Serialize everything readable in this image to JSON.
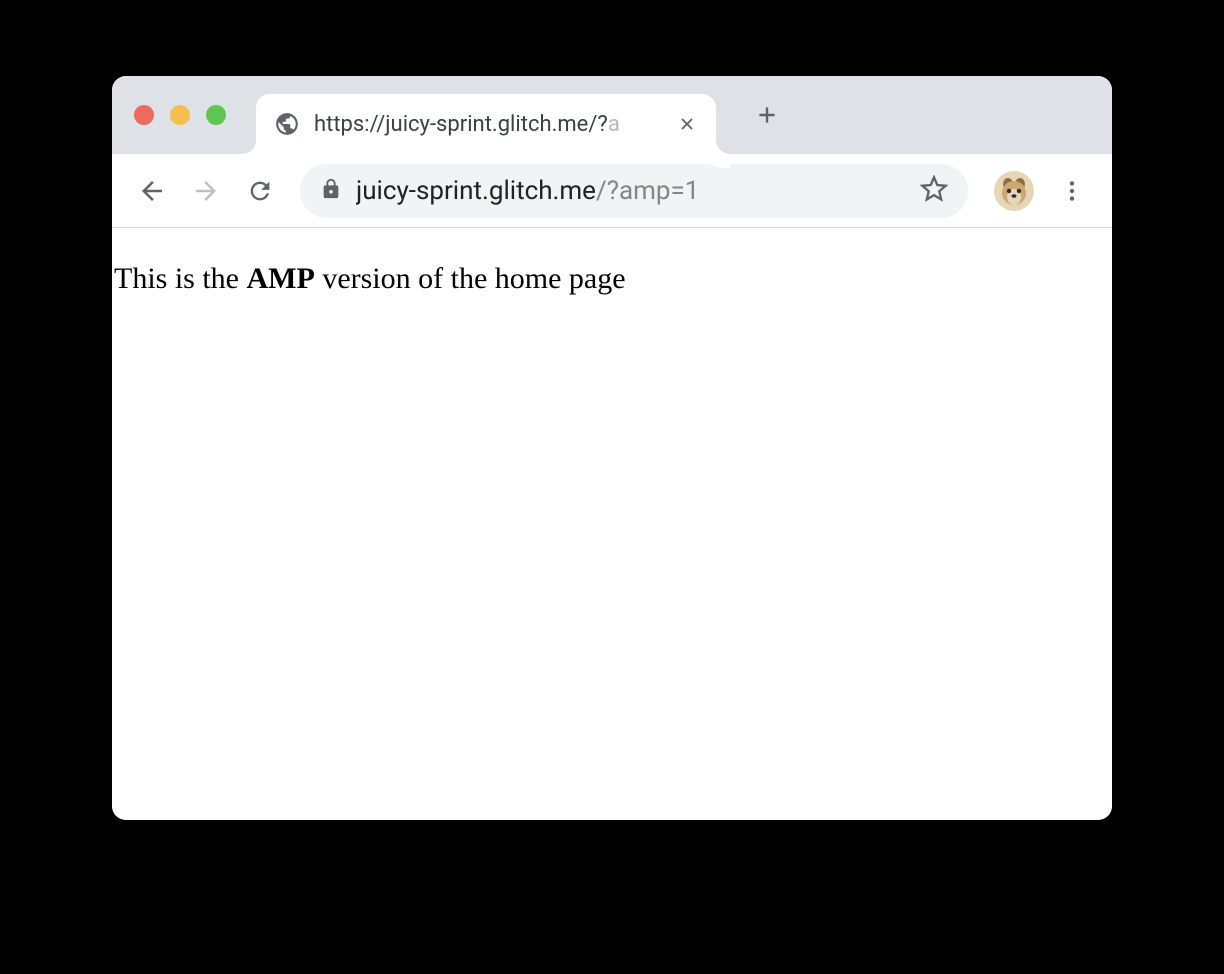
{
  "tab": {
    "title_main": "https://juicy-sprint.glitch.me/?",
    "title_faded": "a"
  },
  "addressbar": {
    "url_host": "juicy-sprint.glitch.me",
    "url_path": "/?amp=1"
  },
  "page": {
    "text_before": "This is the ",
    "text_bold": "AMP",
    "text_after": " version of the home page"
  }
}
